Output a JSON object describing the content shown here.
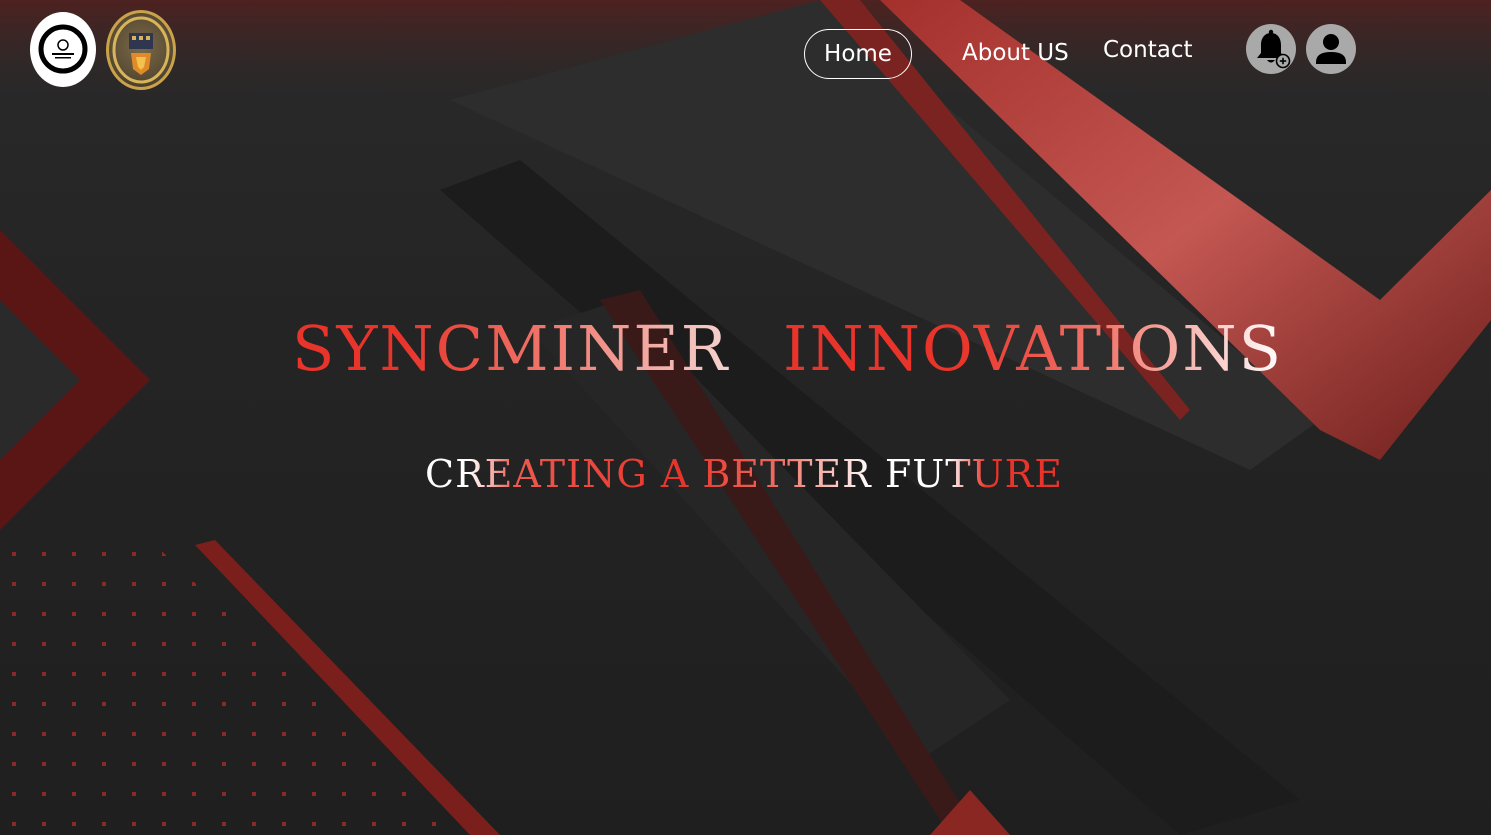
{
  "nav": {
    "home_label": "Home",
    "about_label": "About US",
    "contact_label": "Contact"
  },
  "header": {
    "logo_primary_icon": "syncminer-logo-icon",
    "logo_secondary_icon": "crest-emblem-icon",
    "bell_icon": "bell-plus-icon",
    "user_icon": "user-avatar-icon"
  },
  "hero": {
    "title_part1": "SYNCMINER",
    "title_part2": "INNOVATIONS",
    "subtitle": "CREATING A BETTER FUTURE"
  },
  "colors": {
    "accent": "#e8342a",
    "background": "#232323",
    "text": "#ffffff",
    "icon_button": "#a9a9a9"
  }
}
